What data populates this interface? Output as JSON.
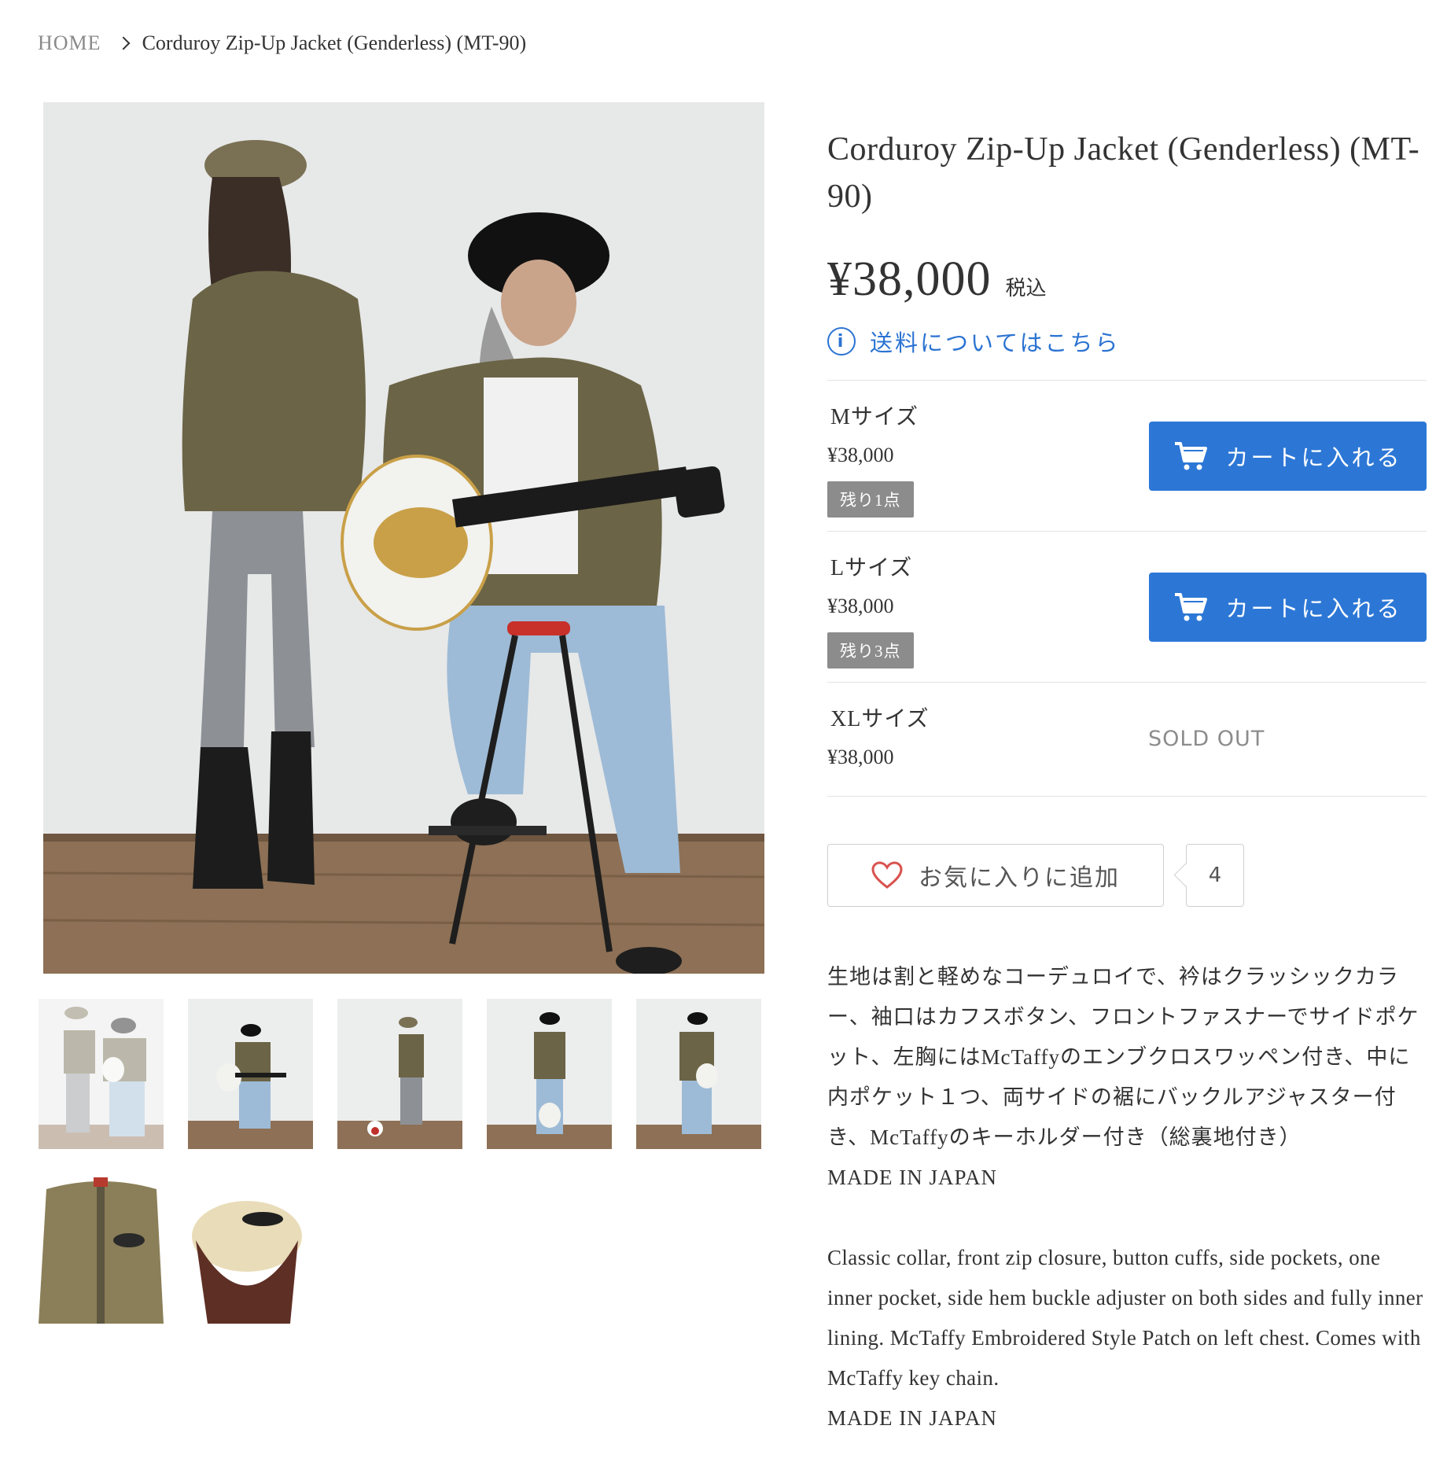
{
  "breadcrumb": {
    "home": "HOME",
    "current": "Corduroy Zip-Up Jacket (Genderless) (MT-90)"
  },
  "product": {
    "title": "Corduroy Zip-Up Jacket (Genderless) (MT-90)",
    "price": "¥38,000",
    "tax_label": "税込",
    "shipping_link": "送料についてはこちら"
  },
  "variants": [
    {
      "name": "Mサイズ",
      "price": "¥38,000",
      "stock": "残り1点",
      "cart_label": "カートに入れる"
    },
    {
      "name": "Lサイズ",
      "price": "¥38,000",
      "stock": "残り3点",
      "cart_label": "カートに入れる"
    },
    {
      "name": "XLサイズ",
      "price": "¥38,000",
      "soldout": "SOLD OUT"
    }
  ],
  "favorite": {
    "label": "お気に入りに追加",
    "count": "4"
  },
  "description": {
    "jp": "生地は割と軽めなコーデュロイで、衿はクラッシックカラー、袖口はカフスボタン、フロントファスナーでサイドポケット、左胸にはMcTaffyのエンブクロスワッペン付き、中に内ポケット１つ、両サイドの裾にバックルアジャスター付き、McTaffyのキーホルダー付き（総裏地付き）",
    "jp_made": "MADE IN JAPAN",
    "en": "Classic collar, front zip closure, button cuffs, side pockets, one inner pocket, side hem buckle adjuster on both sides and fully inner lining. McTaffy Embroidered Style Patch on left chest. Comes with McTaffy key chain.",
    "en_made": "MADE IN JAPAN"
  },
  "colors": {
    "accent": "#2c77d6",
    "stock_badge": "#8c8c8c",
    "jacket": "#6b6446",
    "heart": "#d9534f"
  }
}
